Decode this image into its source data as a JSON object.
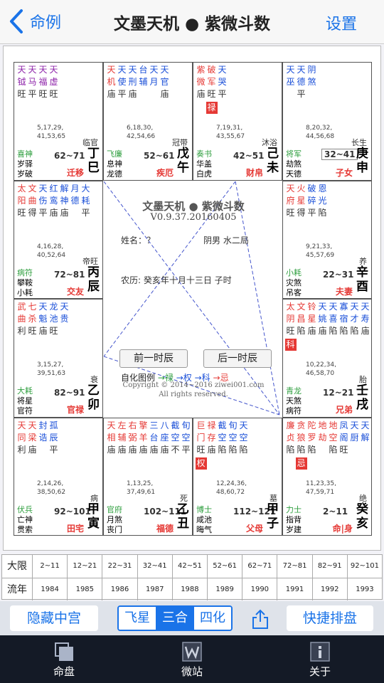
{
  "nav": {
    "back_label": "命例",
    "title": "文墨天机 ● 紫微斗数",
    "settings_label": "设置"
  },
  "cells": [
    {
      "id": "si",
      "cols": [
        [
          "天",
          "钺",
          "旺"
        ],
        [
          "天",
          "马",
          "平"
        ],
        [
          "天",
          "福",
          "旺"
        ],
        [
          "天",
          "虚",
          "旺"
        ]
      ],
      "colors": [
        "pur",
        "pur",
        "pur",
        "pur"
      ],
      "nums": [
        "5,17,29,",
        "41,53,65"
      ],
      "changsheng": "临官",
      "minor": [
        "喜神",
        "岁驿",
        "岁破"
      ],
      "range": "62~71",
      "gan": "丁",
      "zhi": "巳",
      "gong": "迁移"
    },
    {
      "id": "wu",
      "cols": [
        [
          "天",
          "机",
          "庙"
        ],
        [
          "天",
          "使",
          "平"
        ],
        [
          "天",
          "刑",
          "庙"
        ],
        [
          "台",
          "辅",
          ""
        ],
        [
          "天",
          "月",
          ""
        ],
        [
          "天",
          "官",
          "庙"
        ]
      ],
      "colors": [
        "red",
        "blu",
        "blu",
        "blu",
        "blu",
        "blu"
      ],
      "nums": [
        "6,18,30,",
        "42,54,66"
      ],
      "changsheng": "冠带",
      "minor": [
        "飞廉",
        "息神",
        "龙德"
      ],
      "range": "52~61",
      "gan": "戊",
      "zhi": "午",
      "gong": "疾厄"
    },
    {
      "id": "wei",
      "cols": [
        [
          "紫",
          "微",
          "庙"
        ],
        [
          "破",
          "军",
          "旺"
        ],
        [
          "天",
          "哭",
          "平"
        ]
      ],
      "colors": [
        "red",
        "red",
        "blu"
      ],
      "sihua": "禄",
      "sihua_col": 1,
      "nums": [
        "7,19,31,",
        "43,55,67"
      ],
      "changsheng": "沐浴",
      "minor": [
        "奏书",
        "华盖",
        "白虎"
      ],
      "range": "42~51",
      "gan": "己",
      "zhi": "未",
      "gong": "财帛"
    },
    {
      "id": "shen",
      "cols": [
        [
          "天",
          "巫",
          ""
        ],
        [
          "天",
          "德",
          "平"
        ],
        [
          "阴",
          "煞",
          ""
        ]
      ],
      "colors": [
        "blu",
        "blu",
        "blu"
      ],
      "nums": [
        "8,20,32,",
        "44,56,68"
      ],
      "changsheng": "长生",
      "minor": [
        "将军",
        "劫煞",
        "天德"
      ],
      "range": "32~41",
      "boxed": true,
      "gan": "庚",
      "zhi": "申",
      "gong": "子女"
    },
    {
      "id": "chen",
      "cols": [
        [
          "太",
          "阳",
          "旺"
        ],
        [
          "文",
          "曲",
          "得"
        ],
        [
          "天",
          "伤",
          "平"
        ],
        [
          "红",
          "鸾",
          "庙"
        ],
        [
          "解",
          "神",
          "庙"
        ],
        [
          "月",
          "德",
          ""
        ],
        [
          "大",
          "耗",
          "平"
        ]
      ],
      "colors": [
        "red",
        "red",
        "blu",
        "blu",
        "blu",
        "blu",
        "blu"
      ],
      "nums": [
        "4,16,28,",
        "40,52,64"
      ],
      "changsheng": "帝旺",
      "minor": [
        "病符",
        "攀鞍",
        "小耗"
      ],
      "range": "72~81",
      "gan": "丙",
      "zhi": "辰",
      "gong": "交友"
    },
    {
      "id": "you",
      "cols": [
        [
          "天",
          "府",
          "旺"
        ],
        [
          "火",
          "星",
          "得"
        ],
        [
          "破",
          "碎",
          "平"
        ],
        [
          "恩",
          "光",
          "陷"
        ]
      ],
      "colors": [
        "red",
        "red",
        "blu",
        "blu"
      ],
      "nums": [
        "9,21,33,",
        "45,57,69"
      ],
      "changsheng": "养",
      "minor": [
        "小耗",
        "灾煞",
        "吊客"
      ],
      "range": "22~31",
      "gan": "辛",
      "zhi": "酉",
      "gong": "夫妻"
    },
    {
      "id": "mao",
      "cols": [
        [
          "武",
          "曲",
          "利"
        ],
        [
          "七",
          "杀",
          "旺"
        ],
        [
          "天",
          "魁",
          "庙"
        ],
        [
          "龙",
          "池",
          "旺"
        ],
        [
          "天",
          "贵",
          ""
        ]
      ],
      "colors": [
        "red",
        "red",
        "blu",
        "blu",
        "blu"
      ],
      "nums": [
        "3,15,27,",
        "39,51,63"
      ],
      "changsheng": "衰",
      "minor": [
        "大耗",
        "将星",
        "官符"
      ],
      "range": "82~91",
      "gan": "乙",
      "zhi": "卯",
      "gong": "官禄"
    },
    {
      "id": "xu",
      "cols": [
        [
          "太",
          "阴",
          "旺"
        ],
        [
          "文",
          "昌",
          "陷"
        ],
        [
          "铃",
          "星",
          "庙"
        ],
        [
          "天",
          "姚",
          "庙"
        ],
        [
          "天",
          "喜",
          "陷"
        ],
        [
          "寡",
          "宿",
          "陷"
        ],
        [
          "天",
          "才",
          "陷"
        ],
        [
          "天",
          "寿",
          "庙"
        ]
      ],
      "colors": [
        "red",
        "red",
        "red",
        "blu",
        "blu",
        "blu",
        "blu",
        "blu"
      ],
      "sihua": "科",
      "sihua_col": 0,
      "nums": [
        "10,22,34,",
        "46,58,70"
      ],
      "changsheng": "胎",
      "minor": [
        "青龙",
        "天煞",
        "病符"
      ],
      "range": "12~21",
      "gan": "壬",
      "zhi": "戌",
      "gong": "兄弟"
    },
    {
      "id": "yin",
      "cols": [
        [
          "天",
          "同",
          "利"
        ],
        [
          "天",
          "梁",
          "庙"
        ],
        [
          "封",
          "诰",
          ""
        ],
        [
          "孤",
          "辰",
          "平"
        ]
      ],
      "colors": [
        "red",
        "red",
        "blu",
        "blu"
      ],
      "nums": [
        "2,14,26,",
        "38,50,62"
      ],
      "changsheng": "病",
      "minor": [
        "伏兵",
        "亡神",
        "贯索"
      ],
      "range": "92~101",
      "gan": "甲",
      "zhi": "寅",
      "gong": "田宅"
    },
    {
      "id": "chou",
      "cols": [
        [
          "天",
          "相",
          "庙"
        ],
        [
          "左",
          "辅",
          "庙"
        ],
        [
          "右",
          "弼",
          "庙"
        ],
        [
          "擎",
          "羊",
          "庙"
        ],
        [
          "三",
          "台",
          "庙"
        ],
        [
          "八",
          "座",
          "庙"
        ],
        [
          "截",
          "空",
          "不"
        ],
        [
          "旬",
          "空",
          "平"
        ],
        [
          "蜚",
          "廉",
          ""
        ]
      ],
      "colors": [
        "red",
        "red",
        "red",
        "red",
        "blu",
        "blu",
        "blu",
        "blu",
        "blu"
      ],
      "nums": [
        "1,13,25,",
        "37,49,61"
      ],
      "changsheng": "死",
      "minor": [
        "官府",
        "月煞",
        "丧门"
      ],
      "range": "102~111",
      "gan": "乙",
      "zhi": "丑",
      "gong": "福德"
    },
    {
      "id": "zi",
      "cols": [
        [
          "巨",
          "门",
          "旺"
        ],
        [
          "禄",
          "存",
          "庙"
        ],
        [
          "截",
          "空",
          "陷"
        ],
        [
          "旬",
          "空",
          "陷"
        ],
        [
          "天",
          "空",
          "陷"
        ]
      ],
      "colors": [
        "red",
        "red",
        "blu",
        "blu",
        "blu"
      ],
      "sihua": "权",
      "sihua_col": 0,
      "nums": [
        "12,24,36,",
        "48,60,72"
      ],
      "changsheng": "墓",
      "minor": [
        "博士",
        "咸池",
        "晦气"
      ],
      "range": "112~121",
      "gan": "甲",
      "zhi": "子",
      "gong": "父母"
    },
    {
      "id": "hai",
      "cols": [
        [
          "廉",
          "贞",
          "陷"
        ],
        [
          "贪",
          "狼",
          "陷"
        ],
        [
          "陀",
          "罗",
          "陷"
        ],
        [
          "地",
          "劫",
          ""
        ],
        [
          "地",
          "空",
          "陷"
        ],
        [
          "凤",
          "阁",
          "旺"
        ],
        [
          "天",
          "厨",
          ""
        ],
        [
          "天",
          "解",
          ""
        ]
      ],
      "colors": [
        "red",
        "red",
        "red",
        "red",
        "red",
        "blu",
        "blu",
        "blu"
      ],
      "sihua": "忌",
      "sihua_col": 1,
      "nums": [
        "11,23,35,",
        "47,59,71"
      ],
      "changsheng": "绝",
      "minor": [
        "力士",
        "指背",
        "岁建"
      ],
      "range": "2~11",
      "gan": "癸",
      "zhi": "亥",
      "gong": "命|身"
    }
  ],
  "center": {
    "title": "文墨天机 ● 紫微斗数",
    "version": "V0.9.37.20160405",
    "name": "姓名：？",
    "gender": "阴男 水二局",
    "lunar": "农历: 癸亥年十月十三日 子时",
    "prev_btn": "前一时辰",
    "next_btn": "后一时辰",
    "legend_label": "自化图例",
    "legend_lu": "→禄",
    "legend_quan": "→权",
    "legend_ke": "→科",
    "legend_ji": "→忌",
    "copyright": "Copyright © 2014~2016 ziwei001.com",
    "rights": "All rights reserved."
  },
  "table": {
    "daxian_label": "大限",
    "daxian": [
      "2~11",
      "12~21",
      "22~31",
      "32~41",
      "42~51",
      "52~61",
      "62~71",
      "72~81",
      "82~91",
      "92~101"
    ],
    "liunian_label": "流年",
    "liunian": [
      "1984",
      "1985",
      "1986",
      "1987",
      "1988",
      "1989",
      "1990",
      "1991",
      "1992",
      "1993"
    ]
  },
  "toolbar": {
    "hide_label": "隐藏中宫",
    "seg": [
      "飞星",
      "三合",
      "四化"
    ],
    "seg_active": 1,
    "quick_label": "快捷排盘"
  },
  "tabs": [
    {
      "label": "命盘",
      "icon": "chart-icon"
    },
    {
      "label": "微站",
      "icon": "w-icon"
    },
    {
      "label": "关于",
      "icon": "info-icon"
    }
  ],
  "colors": {
    "accent": "#1a73e8",
    "red": "#e53935",
    "blue": "#1a4fd8",
    "purple": "#8e24aa",
    "green": "#2e9e3e",
    "tabbar": "#141a26"
  }
}
